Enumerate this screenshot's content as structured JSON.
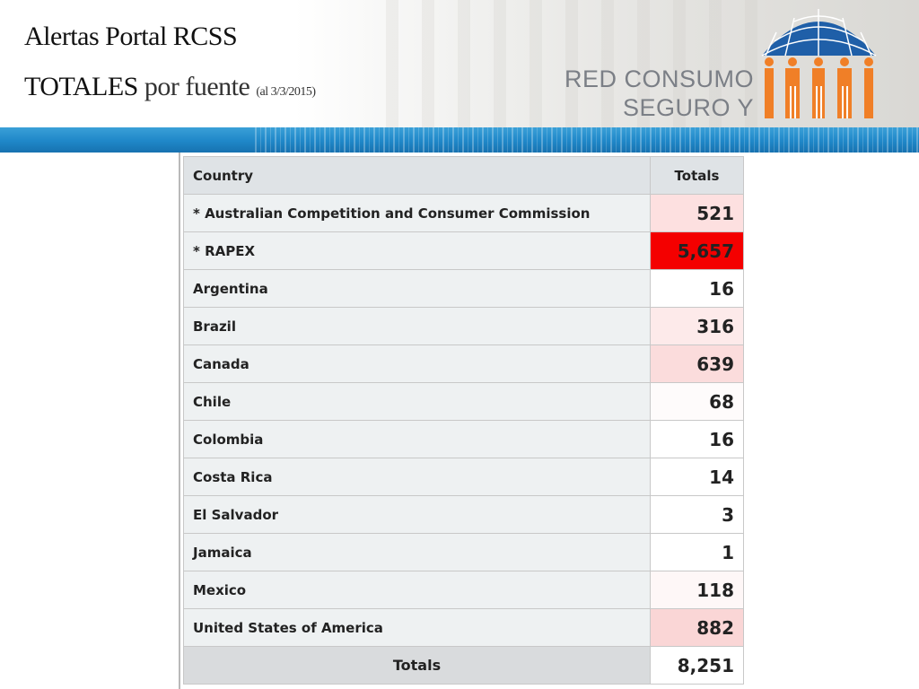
{
  "header": {
    "title_line1": "Alertas Portal RCSS",
    "title_line2_emph": "TOTALES",
    "title_line2_rest": " por fuente ",
    "title_line2_date": "(al 3/3/2015)",
    "brand_line1": "RED CONSUMO",
    "brand_line2": "SEGURO Y SALUD"
  },
  "table": {
    "headers": {
      "country": "Country",
      "totals": "Totals"
    },
    "rows": [
      {
        "country": "* Australian Competition and Consumer Commission",
        "total": "521",
        "shade": "#fde0e0"
      },
      {
        "country": "* RAPEX",
        "total": "5,657",
        "shade": "#f40000"
      },
      {
        "country": "Argentina",
        "total": "16",
        "shade": "#ffffff"
      },
      {
        "country": "Brazil",
        "total": "316",
        "shade": "#fdeaea"
      },
      {
        "country": "Canada",
        "total": "639",
        "shade": "#fbdcdc"
      },
      {
        "country": "Chile",
        "total": "68",
        "shade": "#fefbfb"
      },
      {
        "country": "Colombia",
        "total": "16",
        "shade": "#ffffff"
      },
      {
        "country": "Costa Rica",
        "total": "14",
        "shade": "#ffffff"
      },
      {
        "country": "El Salvador",
        "total": "3",
        "shade": "#ffffff"
      },
      {
        "country": "Jamaica",
        "total": "1",
        "shade": "#ffffff"
      },
      {
        "country": "Mexico",
        "total": "118",
        "shade": "#fef7f7"
      },
      {
        "country": "United States of America",
        "total": "882",
        "shade": "#fad6d6"
      }
    ],
    "footer": {
      "label": "Totals",
      "total": "8,251"
    }
  },
  "colors": {
    "stripe": "#1f87c8",
    "logo_dome": "#1f5fa8",
    "logo_figures": "#f07f27",
    "brand_text": "#7b7f86"
  }
}
